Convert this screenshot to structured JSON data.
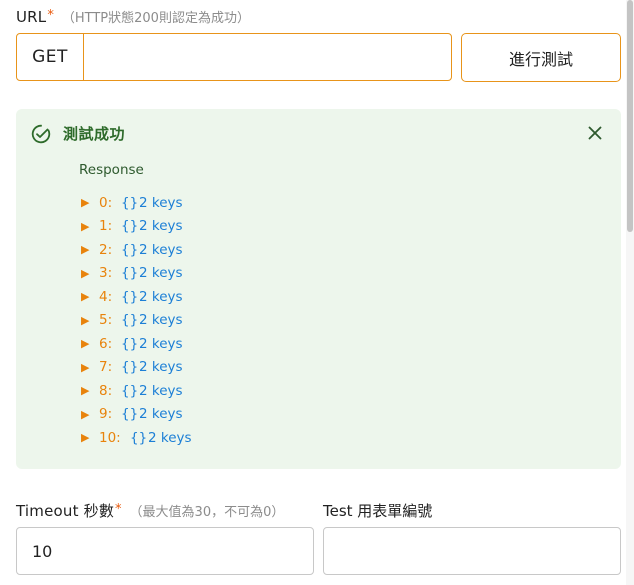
{
  "url_field": {
    "label": "URL",
    "required_mark": "*",
    "hint": "（HTTP狀態200則認定為成功）",
    "method": "GET",
    "value": "",
    "placeholder": ""
  },
  "test_button": {
    "label": "進行測試"
  },
  "result": {
    "title": "測試成功",
    "response_label": "Response",
    "items": [
      {
        "key": "0:",
        "brace": "{}",
        "count": "2 keys"
      },
      {
        "key": "1:",
        "brace": "{}",
        "count": "2 keys"
      },
      {
        "key": "2:",
        "brace": "{}",
        "count": "2 keys"
      },
      {
        "key": "3:",
        "brace": "{}",
        "count": "2 keys"
      },
      {
        "key": "4:",
        "brace": "{}",
        "count": "2 keys"
      },
      {
        "key": "5:",
        "brace": "{}",
        "count": "2 keys"
      },
      {
        "key": "6:",
        "brace": "{}",
        "count": "2 keys"
      },
      {
        "key": "7:",
        "brace": "{}",
        "count": "2 keys"
      },
      {
        "key": "8:",
        "brace": "{}",
        "count": "2 keys"
      },
      {
        "key": "9:",
        "brace": "{}",
        "count": "2 keys"
      },
      {
        "key": "10:",
        "brace": "{}",
        "count": "2 keys"
      }
    ]
  },
  "timeout_field": {
    "label": "Timeout 秒數",
    "required_mark": "*",
    "hint": "（最大值為30，不可為0）",
    "value": "10"
  },
  "test_form_field": {
    "label": "Test 用表單編號",
    "value": ""
  },
  "colors": {
    "accent": "#e8941a",
    "success_bg": "#edf6ec",
    "success_text": "#2e6b2b",
    "tree_key": "#e8830c",
    "tree_value": "#1c7fd6"
  }
}
